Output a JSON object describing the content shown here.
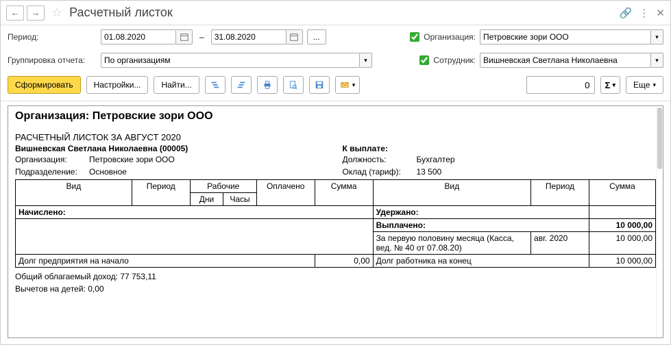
{
  "header": {
    "title": "Расчетный листок"
  },
  "filters": {
    "period_label": "Период:",
    "date_from": "01.08.2020",
    "date_to": "31.08.2020",
    "dash": "–",
    "org_label": "Организация:",
    "org_value": "Петровские зори ООО",
    "group_label": "Группировка отчета:",
    "group_value": "По организациям",
    "employee_label": "Сотрудник:",
    "employee_value": "Вишневская Светлана Николаевна"
  },
  "toolbar": {
    "generate": "Сформировать",
    "settings": "Настройки...",
    "find": "Найти...",
    "num_value": "0",
    "more": "Еще"
  },
  "report": {
    "org_heading": "Организация: Петровские зори ООО",
    "doc_title": "РАСЧЕТНЫЙ ЛИСТОК ЗА АВГУСТ 2020",
    "employee_name": "Вишневская Светлана Николаевна (00005)",
    "left_info": {
      "org_label": "Организация:",
      "org_value": "Петровские зори ООО",
      "dept_label": "Подразделение:",
      "dept_value": "Основное"
    },
    "right_info": {
      "to_pay_label": "К выплате:",
      "position_label": "Должность:",
      "position_value": "Бухгалтер",
      "salary_label": "Оклад (тариф):",
      "salary_value": "13 500"
    },
    "table": {
      "headers": {
        "type": "Вид",
        "period": "Период",
        "work": "Рабочие",
        "days": "Дни",
        "hours": "Часы",
        "paid": "Оплачено",
        "sum": "Сумма",
        "type2": "Вид",
        "period2": "Период",
        "sum2": "Сумма"
      },
      "accrued_label": "Начислено:",
      "withheld_label": "Удержано:",
      "paid_label": "Выплачено:",
      "paid_amount": "10 000,00",
      "payout_row": {
        "desc": "За первую половину месяца (Касса, вед. № 40 от 07.08.20)",
        "period": "авг. 2020",
        "amount": "10 000,00"
      },
      "debt_start_label": "Долг предприятия на начало",
      "debt_start_value": "0,00",
      "debt_end_label": "Долг работника на конец",
      "debt_end_value": "10 000,00"
    },
    "footer": {
      "income": "Общий облагаемый доход: 77 753,11",
      "deductions": "Вычетов на детей: 0,00"
    }
  }
}
